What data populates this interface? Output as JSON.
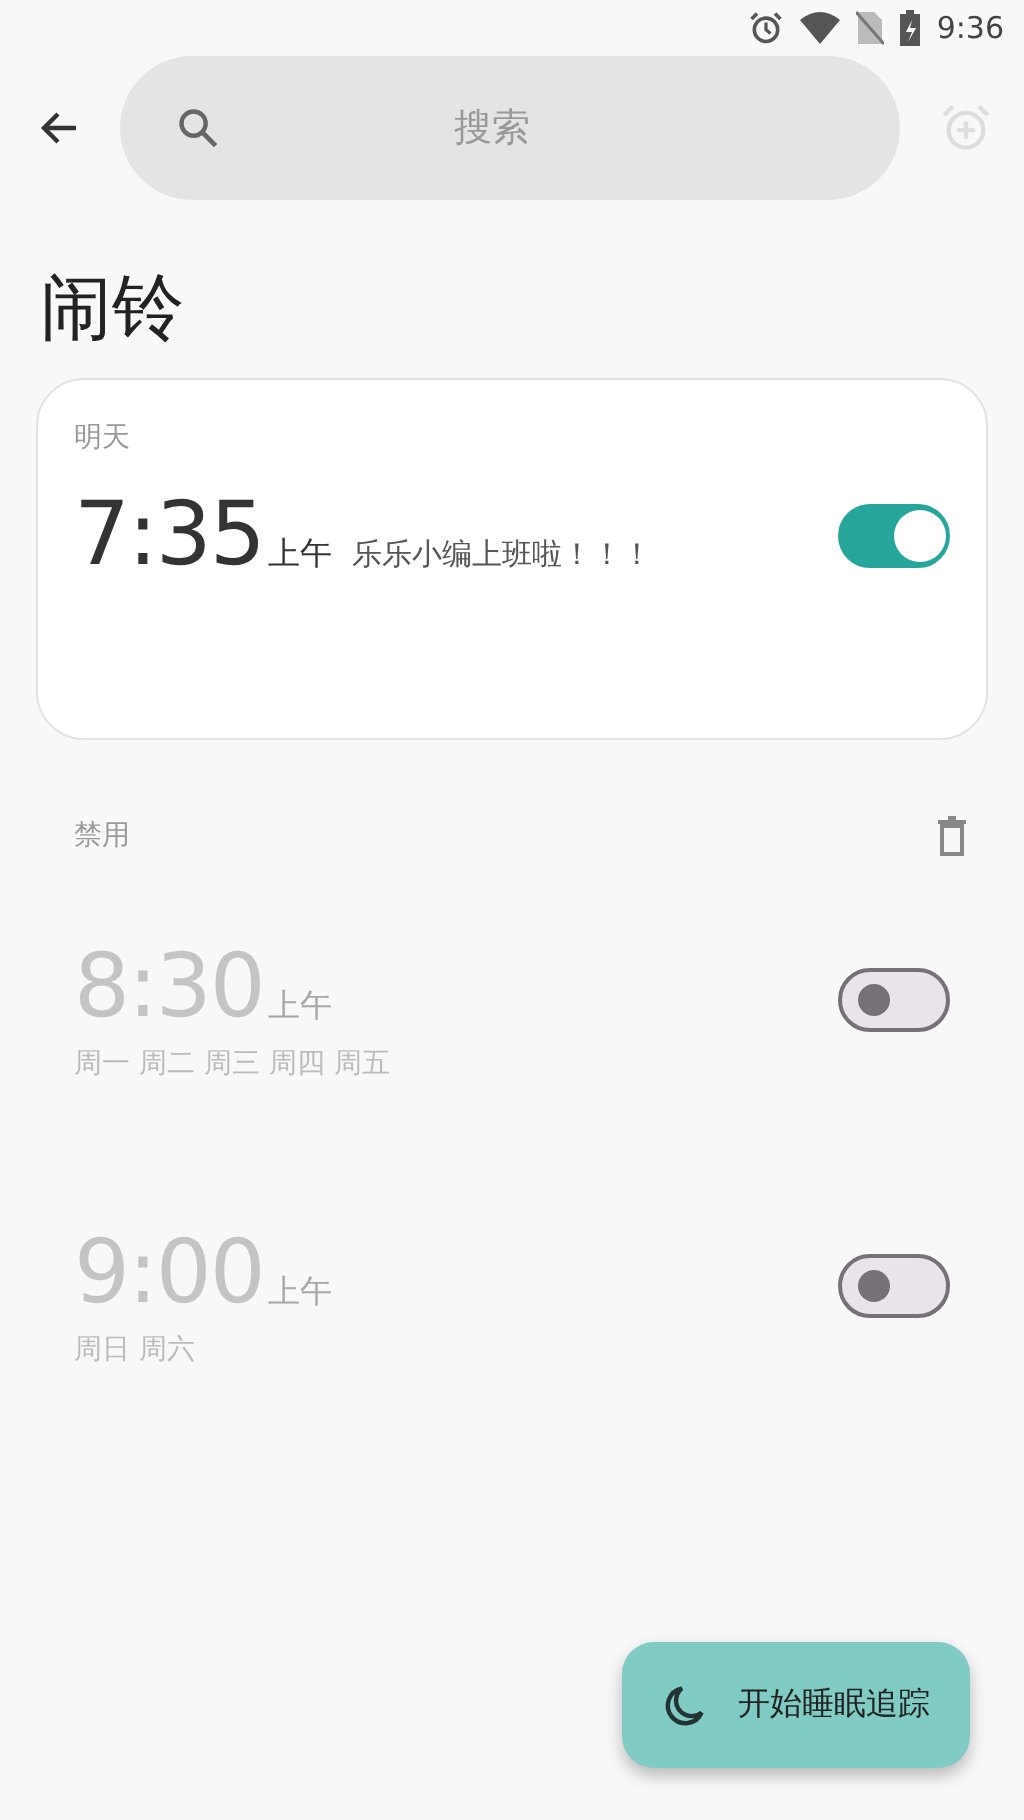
{
  "status_bar": {
    "time": "9:36"
  },
  "search": {
    "placeholder": "搜索"
  },
  "title": "闹铃",
  "upcoming": {
    "label": "明天",
    "alarms": [
      {
        "time": "7:35",
        "period": "上午",
        "note": "乐乐小编上班啦！！！",
        "on": true
      }
    ]
  },
  "disabled_section": {
    "label": "禁用",
    "alarms": [
      {
        "time": "8:30",
        "period": "上午",
        "days": "周一 周二 周三 周四 周五",
        "on": false
      },
      {
        "time": "9:00",
        "period": "上午",
        "days": "周日 周六",
        "on": false
      }
    ]
  },
  "fab": {
    "label": "开始睡眠追踪"
  }
}
